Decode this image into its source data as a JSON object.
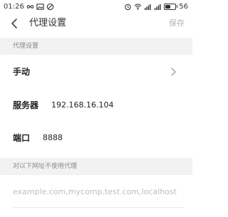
{
  "status_bar": {
    "time": "01:26",
    "battery": "56",
    "battery_level": 0.56
  },
  "header": {
    "title": "代理设置",
    "save_label": "保存"
  },
  "sections": {
    "proxy_settings": "代理设置",
    "bypass": "对以下网址不使用代理"
  },
  "proxy": {
    "mode_label": "手动",
    "server_label": "服务器",
    "server_value": "192.168.16.104",
    "port_label": "端口",
    "port_value": "8888"
  },
  "bypass": {
    "placeholder": "example.com,mycomp.test.com,localhost"
  },
  "icons": {
    "back": "arrow-left-icon",
    "chevron": "chevron-right-icon"
  }
}
